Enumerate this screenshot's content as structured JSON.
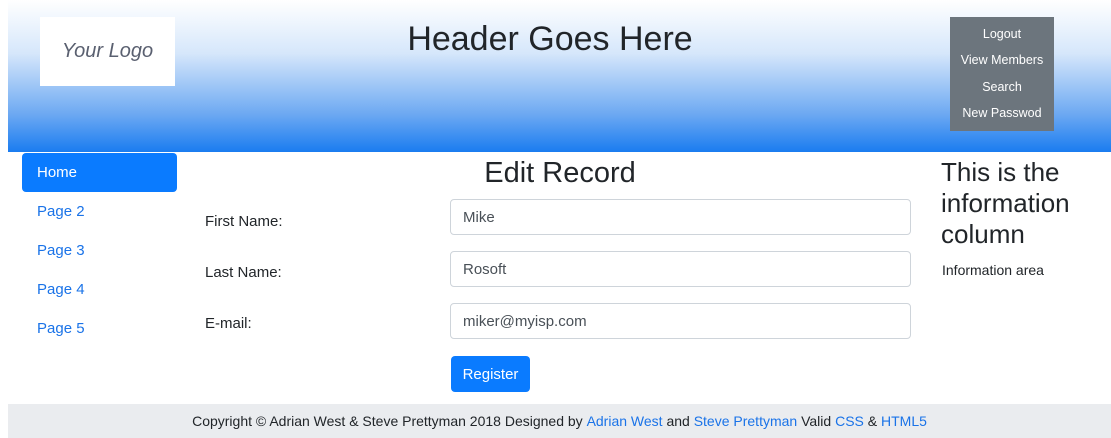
{
  "header": {
    "logo_text": "Your Logo",
    "title": "Header Goes Here",
    "user_menu": [
      "Logout",
      "View Members",
      "Search",
      "New Passwod"
    ]
  },
  "nav": {
    "items": [
      {
        "label": "Home",
        "active": true
      },
      {
        "label": "Page 2",
        "active": false
      },
      {
        "label": "Page 3",
        "active": false
      },
      {
        "label": "Page 4",
        "active": false
      },
      {
        "label": "Page 5",
        "active": false
      }
    ]
  },
  "form": {
    "title": "Edit Record",
    "fields": [
      {
        "label": "First Name:",
        "value": "Mike"
      },
      {
        "label": "Last Name:",
        "value": "Rosoft"
      },
      {
        "label": "E-mail:",
        "value": "miker@myisp.com"
      }
    ],
    "submit_label": "Register"
  },
  "info": {
    "title": "This is the information column",
    "text": "Information area"
  },
  "footer": {
    "text_1": "Copyright © Adrian West & Steve Prettyman 2018 Designed by ",
    "link_1": "Adrian West",
    "text_2": " and ",
    "link_2": "Steve Prettyman",
    "text_3": " Valid ",
    "link_3": "CSS",
    "text_4": " & ",
    "link_4": "HTML5"
  },
  "colors": {
    "primary": "#0a7bff",
    "link": "#1a73e8",
    "menu_bg": "#6c757d",
    "footer_bg": "#eaecef"
  }
}
